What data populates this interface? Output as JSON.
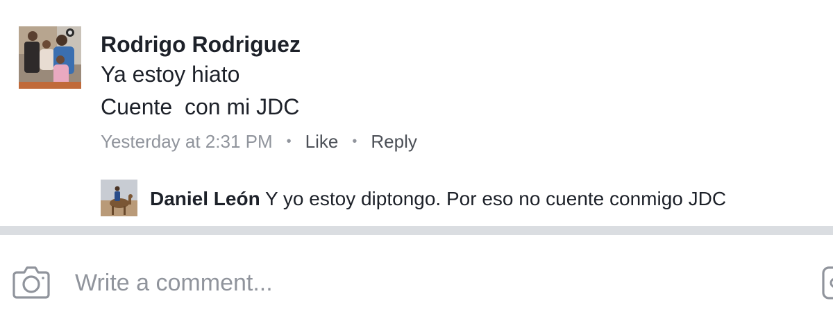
{
  "comment": {
    "author": "Rodrigo Rodriguez",
    "lines": [
      "Ya estoy hiato",
      "Cuente  con mi JDC"
    ],
    "timestamp": "Yesterday at 2:31 PM",
    "separator": "•",
    "like_label": "Like",
    "reply_label": "Reply",
    "avatar_icon": "family-photo-avatar"
  },
  "reply": {
    "author": "Daniel León",
    "text": "Y yo estoy diptongo. Por eso no cuente conmigo JDC",
    "avatar_icon": "camel-rider-avatar"
  },
  "composer": {
    "placeholder": "Write a comment...",
    "camera_icon": "camera-icon",
    "right_icon": "sticker-icon"
  },
  "colors": {
    "text": "#1d2129",
    "meta": "#90949c",
    "action": "#4b4f56",
    "divider": "#dadde1"
  }
}
